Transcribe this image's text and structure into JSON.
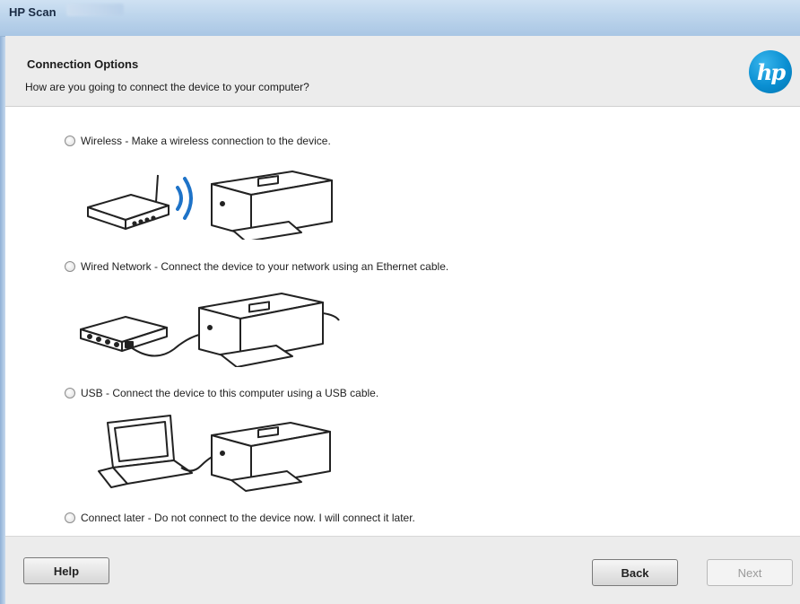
{
  "window": {
    "title": "HP Scan"
  },
  "header": {
    "title": "Connection Options",
    "subtitle": "How are you going to connect the device to your computer?",
    "logo_text": "hp"
  },
  "options": [
    {
      "label": "Wireless - Make a wireless connection to the device.",
      "selected": false
    },
    {
      "label": "Wired Network - Connect the device to your network using an Ethernet cable.",
      "selected": false
    },
    {
      "label": "USB - Connect the device to this computer using a USB cable.",
      "selected": false
    },
    {
      "label": "Connect later - Do not connect to the device now. I will connect it later.",
      "selected": false
    }
  ],
  "buttons": {
    "help": "Help",
    "back": "Back",
    "next": "Next",
    "next_enabled": false
  },
  "colors": {
    "hp_blue": "#0a8fd2",
    "titlebar": "#bdd5ec",
    "header_bg": "#ececec",
    "wifi_waves": "#1e73c8"
  }
}
